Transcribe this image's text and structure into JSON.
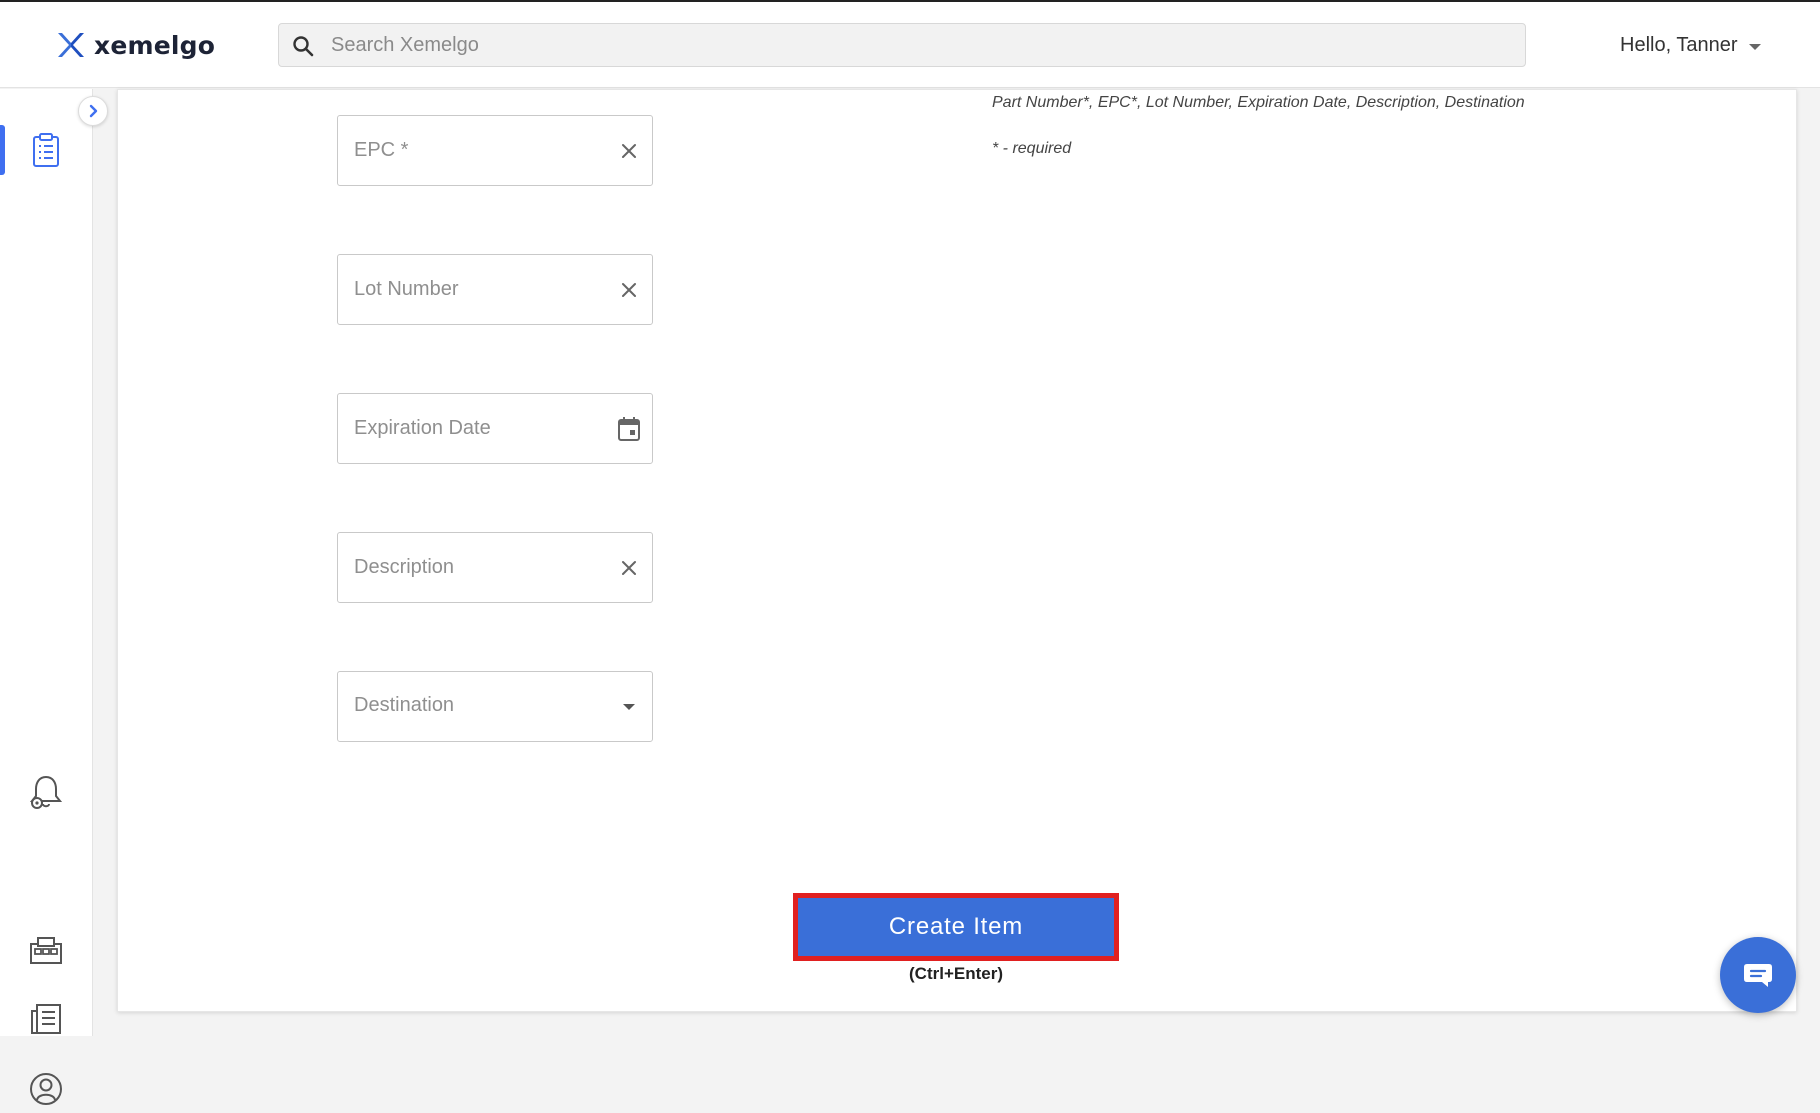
{
  "header": {
    "logo_text": "xemelgo",
    "search_placeholder": "Search Xemelgo",
    "greeting": "Hello, Tanner"
  },
  "sidebar": {
    "items": [
      {
        "name": "clipboard-icon",
        "active": true
      },
      {
        "name": "bell-gear-icon",
        "active": false
      },
      {
        "name": "building-icon",
        "active": false
      },
      {
        "name": "report-list-icon",
        "active": false
      },
      {
        "name": "user-circle-icon",
        "active": false
      }
    ],
    "accent_color": "#3f6ff0"
  },
  "form": {
    "instructions": "Part Number*, EPC*, Lot Number, Expiration Date, Description, Destination",
    "required_note": "* - required",
    "fields": {
      "epc": {
        "placeholder": "EPC *",
        "value": ""
      },
      "lot_number": {
        "placeholder": "Lot Number",
        "value": ""
      },
      "expiration_date": {
        "placeholder": "Expiration Date",
        "value": ""
      },
      "description": {
        "placeholder": "Description",
        "value": ""
      },
      "destination": {
        "label": "Destination",
        "selected": ""
      }
    },
    "submit_label": "Create Item",
    "submit_shortcut": "(Ctrl+Enter)",
    "submit_color": "#3a6fd8",
    "highlight_color": "#e02020"
  }
}
